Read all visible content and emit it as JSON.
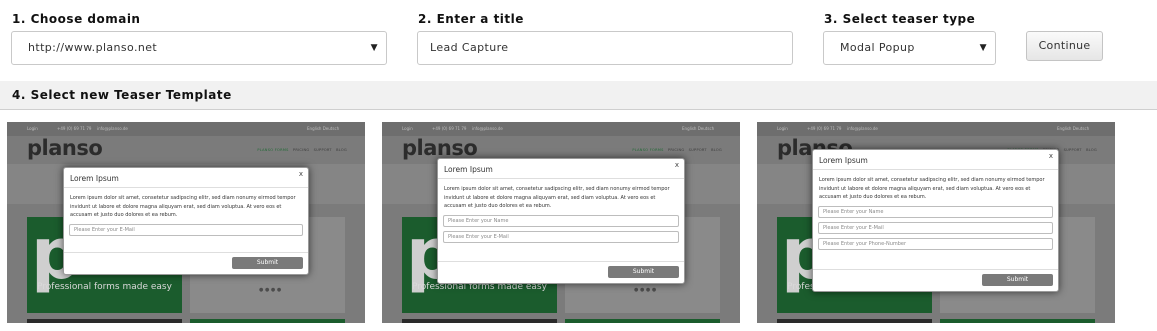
{
  "steps": {
    "domain": {
      "label": "1. Choose domain",
      "value": "http://www.planso.net"
    },
    "title": {
      "label": "2. Enter a title",
      "value": "Lead Capture"
    },
    "teaser_type": {
      "label": "3. Select teaser type",
      "value": "Modal Popup"
    },
    "continue_label": "Continue",
    "template_label": "4. Select new Teaser Template"
  },
  "preview": {
    "logo": "planso",
    "tagline": "Professional forms made easy",
    "nav_items": [
      "PLANSO FORMS",
      "PRICING",
      "SUPPORT",
      "BLOG"
    ],
    "login": "Login",
    "phone": "+49 (0) 69 71 79",
    "email": "info@planso.de",
    "lang": "English  Deutsch"
  },
  "templates": [
    {
      "modal_title": "Lorem Ipsum",
      "close": "x",
      "body": "Lorem ipsum dolor sit amet, consetetur sadipscing elitr, sed diam nonumy eirmod tempor invidunt ut labore et dolore magna aliquyam erat, sed diam voluptua. At vero eos et accusam et justo duo dolores et ea rebum.",
      "fields": [
        "Please Enter your E-Mail"
      ],
      "submit": "Submit"
    },
    {
      "modal_title": "Lorem Ipsum",
      "close": "x",
      "body": "Lorem ipsum dolor sit amet, consetetur sadipscing elitr, sed diam nonumy eirmod tempor invidunt ut labore et dolore magna aliquyam erat, sed diam voluptua. At vero eos et accusam et justo duo dolores et ea rebum.",
      "fields": [
        "Please Enter your Name",
        "Please Enter your E-Mail"
      ],
      "submit": "Submit"
    },
    {
      "modal_title": "Lorem Ipsum",
      "close": "x",
      "body": "Lorem ipsum dolor sit amet, consetetur sadipscing elitr, sed diam nonumy eirmod tempor invidunt ut labore et dolore magna aliquyam erat, sed diam voluptua. At vero eos et accusam et justo duo dolores et ea rebum.",
      "fields": [
        "Please Enter your Name",
        "Please Enter your E-Mail",
        "Please Enter your Phone-Number"
      ],
      "submit": "Submit"
    }
  ]
}
